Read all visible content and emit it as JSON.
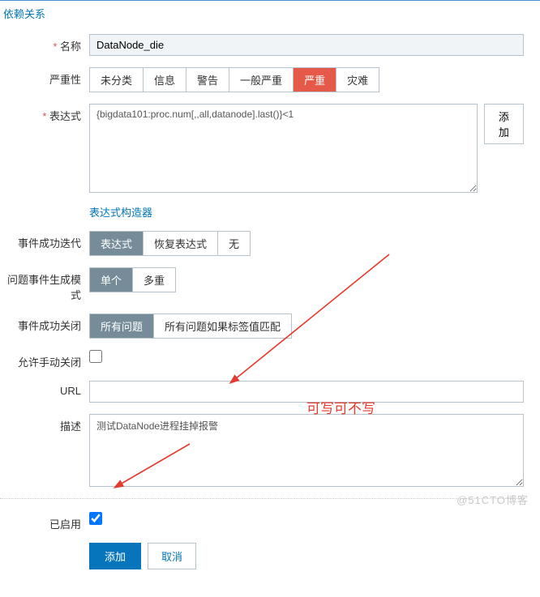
{
  "tab": {
    "dependency": "依赖关系"
  },
  "labels": {
    "name": "名称",
    "severity": "严重性",
    "expression": "表达式",
    "builder": "表达式构造器",
    "iteration": "事件成功迭代",
    "gen_mode": "问题事件生成模式",
    "close_ok": "事件成功关闭",
    "manual_close": "允许手动关闭",
    "url": "URL",
    "description": "描述",
    "enabled": "已启用"
  },
  "fields": {
    "name_value": "DataNode_die",
    "expression_value": "{bigdata101:proc.num[,,all,datanode].last()}<1",
    "url_value": "",
    "description_value": "测试DataNode进程挂掉报警"
  },
  "severity_opts": [
    "未分类",
    "信息",
    "警告",
    "一般严重",
    "严重",
    "灾难"
  ],
  "severity_selected": 4,
  "iteration_opts": [
    "表达式",
    "恢复表达式",
    "无"
  ],
  "iteration_selected": 0,
  "gen_opts": [
    "单个",
    "多重"
  ],
  "gen_selected": 0,
  "close_opts": [
    "所有问题",
    "所有问题如果标签值匹配"
  ],
  "close_selected": 0,
  "buttons": {
    "add_side": "添加",
    "add": "添加",
    "cancel": "取消"
  },
  "annotation": "可写可不写",
  "watermark": "@51CTO博客"
}
